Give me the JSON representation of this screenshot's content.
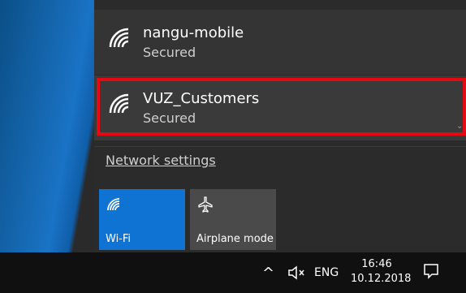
{
  "networks": [
    {
      "ssid": "nangu-mobile",
      "status": "Secured"
    },
    {
      "ssid": "VUZ_Customers",
      "status": "Secured"
    }
  ],
  "network_settings_label": "Network settings",
  "quick_actions": [
    {
      "label": "Wi-Fi",
      "active": true
    },
    {
      "label": "Airplane mode",
      "active": false
    }
  ],
  "taskbar": {
    "language": "ENG",
    "time": "16:46",
    "date": "10.12.2018"
  },
  "colors": {
    "accent": "#0e73d3",
    "highlight": "#e50914",
    "flyout_bg": "#2b2b2b",
    "taskbar_bg": "#101010"
  },
  "icons": {
    "network": "wifi-icon",
    "airplane": "airplane-icon",
    "overflow": "chevron-up-icon",
    "volume": "speaker-muted-icon",
    "notifications": "action-center-icon"
  }
}
